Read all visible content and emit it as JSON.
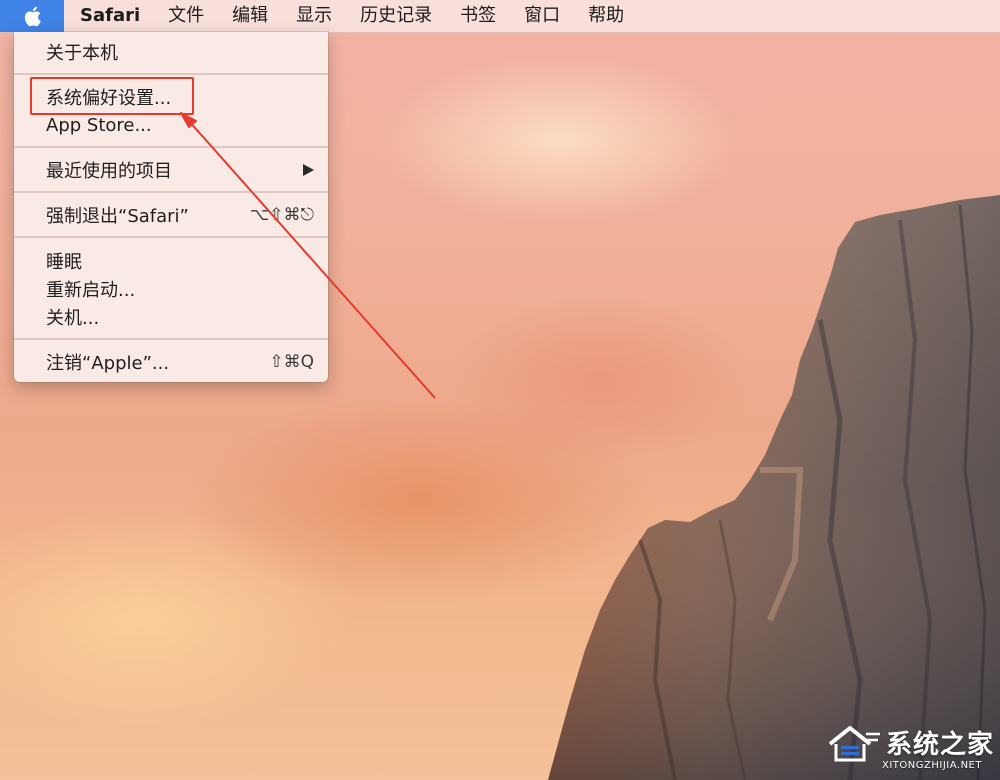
{
  "menubar": {
    "apple_icon": "apple-icon",
    "app_name": "Safari",
    "items": [
      "文件",
      "编辑",
      "显示",
      "历史记录",
      "书签",
      "窗口",
      "帮助"
    ]
  },
  "apple_menu": {
    "about": "关于本机",
    "system_prefs": "系统偏好设置...",
    "app_store": "App Store...",
    "recent_items": "最近使用的项目",
    "force_quit": "强制退出“Safari”",
    "force_quit_shortcut": "⌥⇧⌘⎋",
    "sleep": "睡眠",
    "restart": "重新启动...",
    "shutdown": "关机...",
    "logout": "注销“Apple”...",
    "logout_shortcut": "⇧⌘Q"
  },
  "colors": {
    "apple_highlight": "#3f83e6",
    "annotation_red": "#e53b2e"
  },
  "watermark": {
    "name": "系统之家",
    "url": "XITONGZHIJIA.NET"
  }
}
